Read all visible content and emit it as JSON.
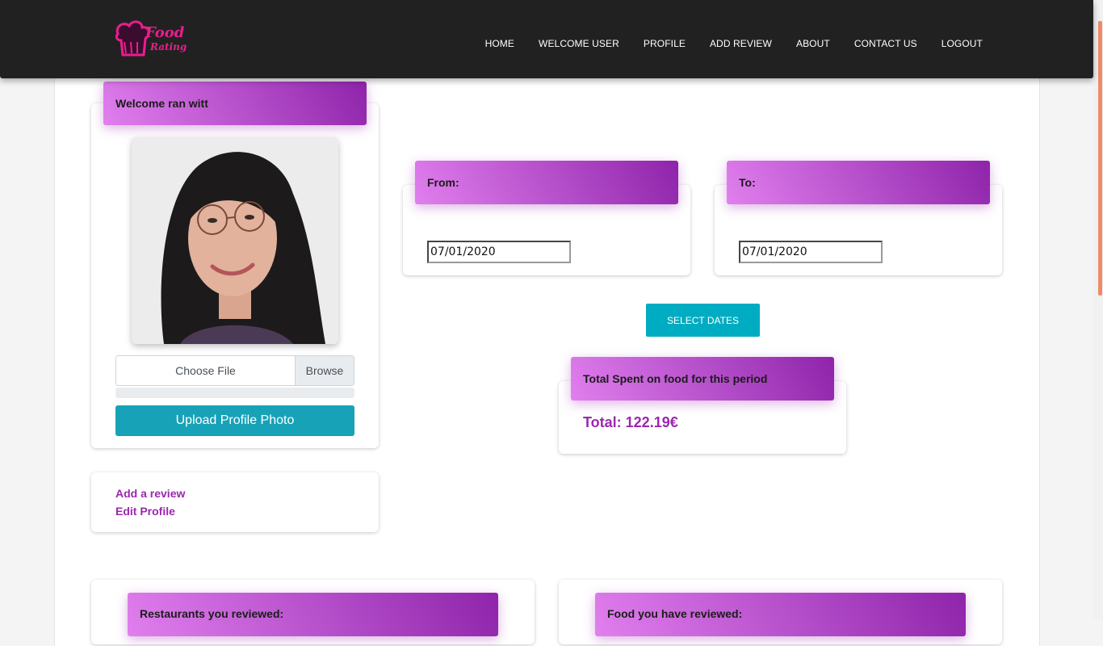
{
  "logo": {
    "line1": "Food",
    "line2": "Rating"
  },
  "nav": {
    "items": [
      "HOME",
      "WELCOME USER",
      "PROFILE",
      "ADD REVIEW",
      "ABOUT",
      "CONTACT US",
      "LOGOUT"
    ]
  },
  "profile": {
    "welcome": "Welcome ran witt",
    "file_label": "Choose File",
    "browse_label": "Browse",
    "upload_label": "Upload Profile Photo"
  },
  "links": {
    "add_review": "Add a review",
    "edit_profile": "Edit Profile"
  },
  "dates": {
    "from_label": "From:",
    "to_label": "To:",
    "from_value": "07/01/2020",
    "to_value": "07/01/2020",
    "select_label": "SELECT DATES"
  },
  "total": {
    "header": "Total Spent on food for this period",
    "value": "Total: 122.19€"
  },
  "sections": {
    "restaurants": "Restaurants you reviewed:",
    "food": "Food you have reviewed:"
  },
  "colors": {
    "navbar": "#212121",
    "header_gradient_start": "#e17fee",
    "header_gradient_end": "#8e24aa",
    "link": "#9c27b0",
    "upload_button": "#17a2b8",
    "select_button": "#00acc1"
  }
}
